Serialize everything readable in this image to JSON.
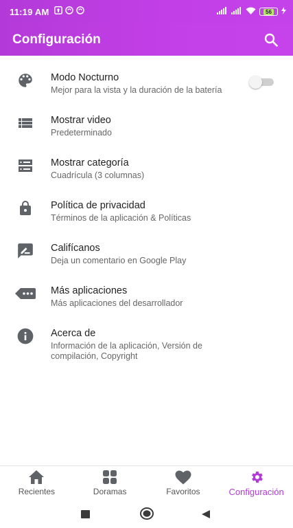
{
  "status_bar": {
    "time": "11:19 AM",
    "battery": "56",
    "icons": [
      "upload-icon",
      "sync-icon",
      "sync-icon",
      "signal-icon",
      "signal-icon",
      "wifi-icon",
      "battery-icon",
      "charging-icon"
    ]
  },
  "app_bar": {
    "title": "Configuración",
    "search_icon": "search-icon"
  },
  "colors": {
    "primary": "#c03ee6",
    "active_nav": "#b23ad8",
    "icon_gray": "#5f6368"
  },
  "settings": [
    {
      "title": "Modo Nocturno",
      "subtitle": "Mejor para la vista y la duración de la batería",
      "icon": "palette-icon",
      "toggle": false
    },
    {
      "title": "Mostrar video",
      "subtitle": "Predeterminado",
      "icon": "list-icon"
    },
    {
      "title": "Mostrar categoría",
      "subtitle": "Cuadrícula (3 columnas)",
      "icon": "storage-icon"
    },
    {
      "title": "Política de privacidad",
      "subtitle": "Términos de la aplicación & Políticas",
      "icon": "lock-icon"
    },
    {
      "title": "Califícanos",
      "subtitle": "Deja un comentario en Google Play",
      "icon": "rate-review-icon"
    },
    {
      "title": "Más aplicaciones",
      "subtitle": "Más aplicaciones del desarrollador",
      "icon": "more-apps-icon"
    },
    {
      "title": "Acerca de",
      "subtitle": "Información de la aplicación, Versión de compilación, Copyright",
      "icon": "info-icon"
    }
  ],
  "bottom_nav": [
    {
      "label": "Recientes",
      "icon": "home-icon",
      "active": false
    },
    {
      "label": "Doramas",
      "icon": "grid-icon",
      "active": false
    },
    {
      "label": "Favoritos",
      "icon": "heart-icon",
      "active": false
    },
    {
      "label": "Configuración",
      "icon": "gear-icon",
      "active": true
    }
  ],
  "system_nav": [
    "recents-square-icon",
    "home-circle-icon",
    "back-triangle-icon"
  ]
}
